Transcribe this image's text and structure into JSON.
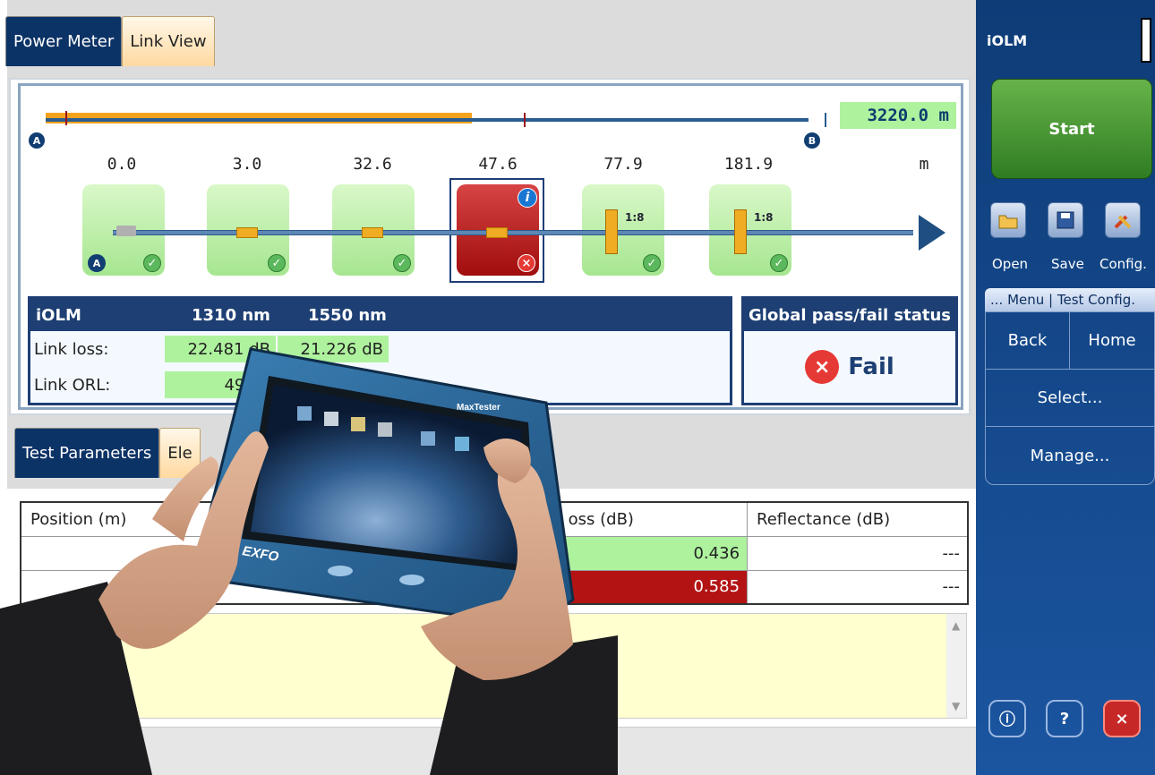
{
  "tabs": [
    {
      "label": "Power Meter"
    },
    {
      "label": "Link View"
    }
  ],
  "link_view": {
    "total_distance": "3220.0 m",
    "marker_a": "A",
    "marker_b": "B",
    "positions": [
      "0.0",
      "3.0",
      "32.6",
      "47.6",
      "77.9",
      "181.9"
    ],
    "unit": "m",
    "split_ratio": "1:8",
    "launch_label": "A"
  },
  "results": {
    "header": {
      "name": "iOLM",
      "col1": "1310 nm",
      "col2": "1550 nm"
    },
    "rows": [
      {
        "label": "Link loss:",
        "v1": "22.481 dB",
        "v2": "21.226 dB"
      },
      {
        "label": "Link ORL:",
        "v1": "49.26",
        "v2": ""
      }
    ]
  },
  "global": {
    "title": "Global pass/fail status",
    "status": "Fail"
  },
  "lower_tabs": [
    {
      "label": "Test Parameters"
    },
    {
      "label": "Ele"
    }
  ],
  "table": {
    "headers": [
      "Position (m)",
      "oss (dB)",
      "Reflectance (dB)"
    ],
    "rows": [
      {
        "loss": "0.436",
        "reflectance": "---"
      },
      {
        "loss": "0.585",
        "reflectance": "---"
      }
    ]
  },
  "panel": {
    "title": "iOLM",
    "start": "Start",
    "open": "Open",
    "save": "Save",
    "config": "Config.",
    "menu_tab": "... Menu | Test Config.",
    "back": "Back",
    "home": "Home",
    "select": "Select...",
    "manage": "Manage..."
  },
  "device": {
    "brand": "EXFO",
    "model": "MaxTester"
  },
  "colors": {
    "navy": "#0c3366",
    "pass_green": "#aef29e",
    "fail_red": "#b31313",
    "start_green": "#2f7d23"
  }
}
